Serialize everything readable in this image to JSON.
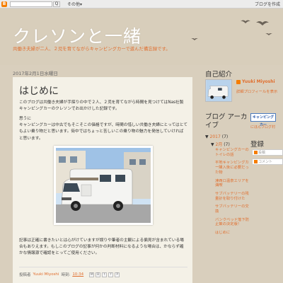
{
  "navbar": {
    "logo_label": "B",
    "search_button": "Q",
    "more": "その他▾",
    "create_blog": "ブログを作成"
  },
  "header": {
    "title": "クレソンと一緒",
    "description": "共働き夫婦が二人、２児を育てながらキャンピングカーで遊んだ備忘録です。"
  },
  "post": {
    "date": "2017年2月1日水曜日",
    "title": "はじめに",
    "paragraphs": [
      "このブログは共働き夫婦が手探りの中で２人、２児を育てながら時間を見つけてはNas社製キャンピングカーのクレソンでお出かけした記録です。",
      "思うに\nキャンピングカーは中古でもそこそこの価格ですが、時間の惜しい共働き夫婦にとってはとてもよい乗り物だと思います。街中ではちょっと苦しいこの乗り物の魅力を発信していければと思います。",
      "記事は正確に書きたいとは心がけていますが誤りや筆者の主観による偏見が含まれている場合もありえます。もしこのブログの記事が何かの判断材料になるような場合は、かならず確かな情報源で確認をとってご使用ください。"
    ],
    "footer": {
      "posted_by": "投稿者",
      "author": "Yuuki Miyoshi",
      "time_label": "時刻:",
      "time": "10:34"
    },
    "share_icons": [
      "M",
      "B",
      "t",
      "f",
      "P"
    ]
  },
  "sidebar": {
    "profile_heading": "自己紹介",
    "profile_name": "Yuuki Miyoshi",
    "profile_link": "詳細プロフィールを表示",
    "archive_heading": "ブログ アーカイブ",
    "archive_year": "2017",
    "archive_year_count": "(7)",
    "archive_month": "2月",
    "archive_month_count": "(7)",
    "archive_posts": [
      "キャンピングカーのトイレの話",
      "平地キャンピングカー購入後に必要だった物",
      "凍西ロ温泉エリアを満喫",
      "サブバッテリーの残量計を取り付けた",
      "サブバッテリーの交換",
      "バンクベッド落下防止策の決定版！",
      "はじめに"
    ],
    "badge_label": "キャンピングカー",
    "ranking_link": "にほんブログ村",
    "login_heading": "登録",
    "login_fields": [
      "投稿",
      "コメント"
    ]
  }
}
